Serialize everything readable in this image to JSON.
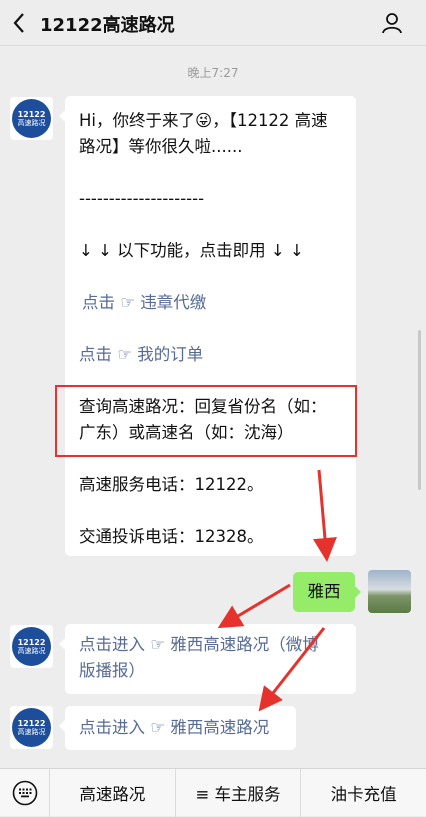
{
  "header": {
    "title": "12122高速路况"
  },
  "timestamp": "晚上7:27",
  "avatar": {
    "line1": "12122",
    "line2": "高速路况"
  },
  "message1": {
    "greeting": "Hi，你终于来了😜，【12122 高速",
    "greeting2": "路况】等你很久啦......",
    "divider": "---------------------",
    "features": "↓ ↓ 以下功能，点击即用 ↓ ↓",
    "violation_link": "点击 ☞ 违章代缴",
    "orders_link": "点击 ☞ 我的订单",
    "query1": "查询高速路况：回复省份名（如：",
    "query2": "广东）或高速名（如：沈海）",
    "service_phone": "高速服务电话：12122。",
    "complaint_phone": "交通投诉电话：12328。"
  },
  "sent_message": "雅西",
  "message2": {
    "line1_prefix": "点击进入 ☞ ",
    "line1_link": "雅西高速路况（微博",
    "line2_link": "版播报）"
  },
  "message3": {
    "prefix": "点击进入 ☞ ",
    "link": "雅西高速路况"
  },
  "bottom_menu": [
    "高速路况",
    "≡ 车主服务",
    "油卡充值"
  ],
  "colors": {
    "link": "#576b95",
    "sent_bubble": "#95ec69",
    "highlight_box": "#e5322d",
    "brand": "#1d4e9b"
  }
}
